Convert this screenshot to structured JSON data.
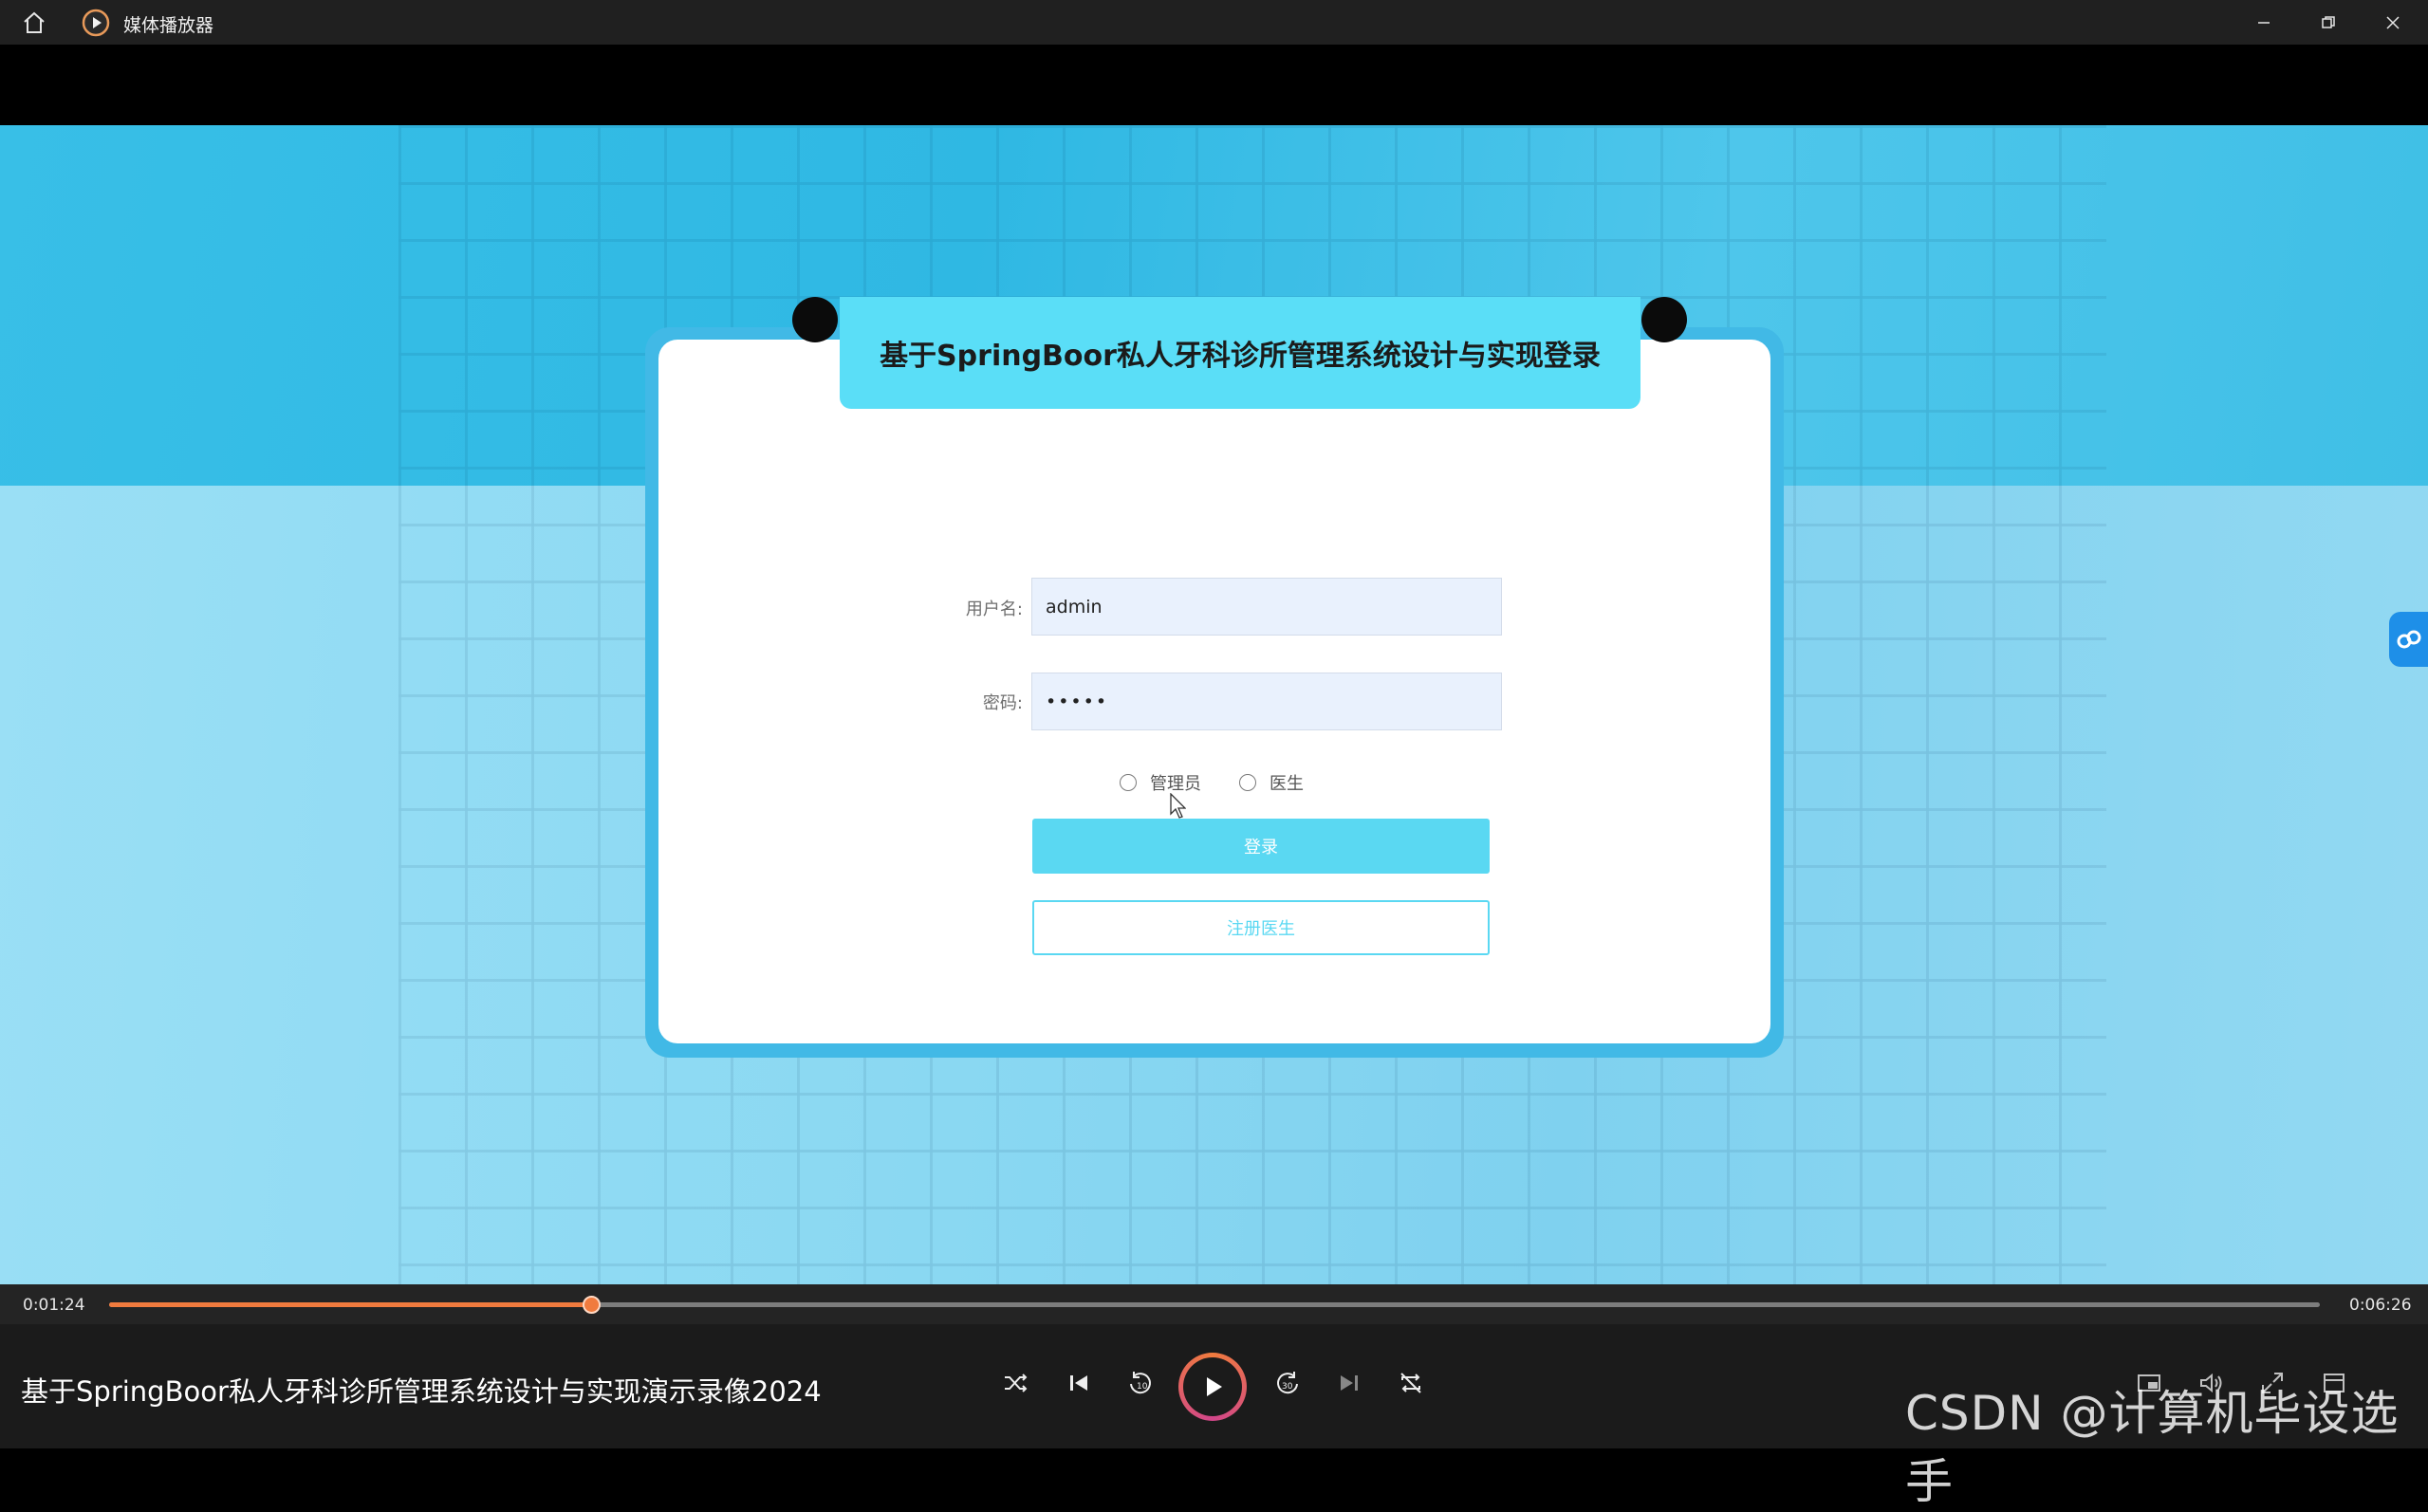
{
  "window": {
    "app_title": "媒体播放器"
  },
  "login": {
    "title": "基于SpringBoor私人牙科诊所管理系统设计与实现登录",
    "username_label": "用户名:",
    "username_value": "admin",
    "password_label": "密码:",
    "password_value": "•••••",
    "roles": [
      "管理员",
      "医生"
    ],
    "login_button": "登录",
    "register_button": "注册医生"
  },
  "player": {
    "current_time": "0:01:24",
    "total_time": "0:06:26",
    "progress_fraction": 0.218,
    "media_title": "基于SpringBoor私人牙科诊所管理系统设计与实现演示录像2024",
    "controls": [
      "shuffle-icon",
      "previous-icon",
      "rewind-10-icon",
      "play-icon",
      "forward-30-icon",
      "next-icon",
      "repeat-off-icon"
    ],
    "right_controls": [
      "miniplayer-icon",
      "volume-icon",
      "fullscreen-icon",
      "more-icon"
    ]
  },
  "watermark": "CSDN @计算机毕设选手",
  "colors": {
    "accent": "#f07b3e",
    "login_header": "#5adef7",
    "login_button": "#5ad8f2",
    "card_border": "#41b9e6"
  }
}
